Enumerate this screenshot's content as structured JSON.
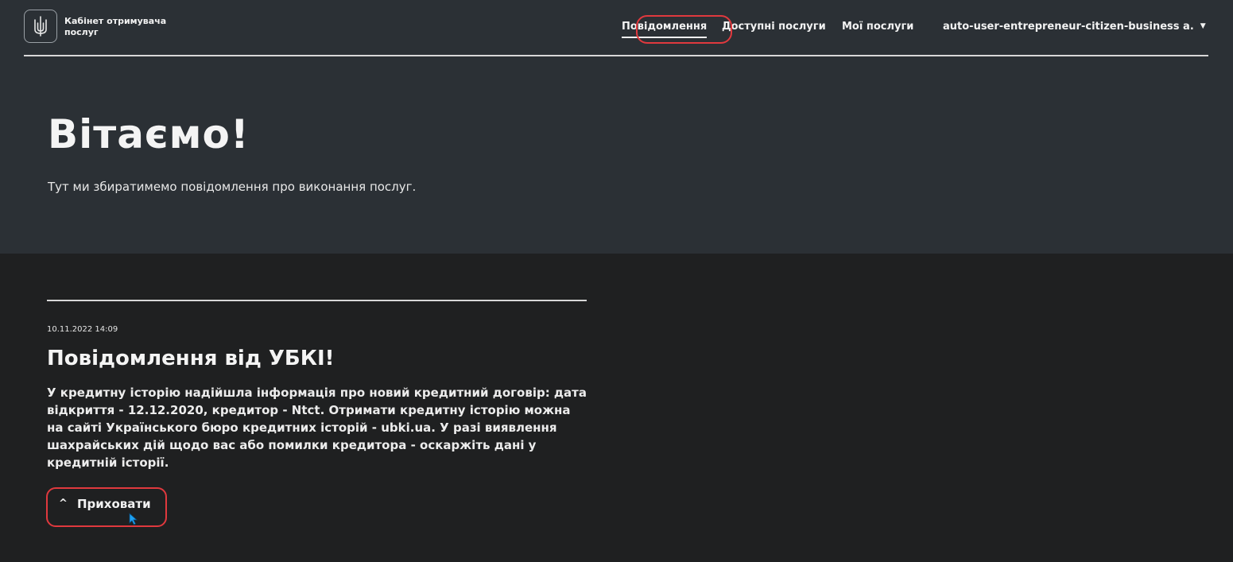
{
  "header": {
    "brand": "Кабінет отримувача послуг",
    "nav": {
      "notifications": "Повідомлення",
      "available_services": "Доступні послуги",
      "my_services": "Мої послуги",
      "user": "auto-user-entrepreneur-citizen-business a."
    }
  },
  "hero": {
    "title": "Вітаємо!",
    "subtitle": "Тут ми збиратимемо повідомлення про виконання послуг."
  },
  "message": {
    "date": "10.11.2022 14:09",
    "title": "Повідомлення від УБКІ!",
    "body": "У кредитну історію надійшла інформація про новий кредитний договір: дата відкриття - 12.12.2020, кредитор - Ntct. Отримати кредитну історію можна на сайті Українського бюро кредитних історій - ubki.ua. У разі виявлення шахрайських дій щодо вас або помилки кредитора - оскаржіть дані у кредитній історії.",
    "hide_label": "Приховати"
  },
  "colors": {
    "hero_bg": "#2b3035",
    "page_bg": "#1f2021",
    "highlight": "#e0393e"
  },
  "icons": {
    "logo": "trident-icon",
    "user_menu": "caret-down-icon",
    "hide": "chevron-up-icon"
  }
}
